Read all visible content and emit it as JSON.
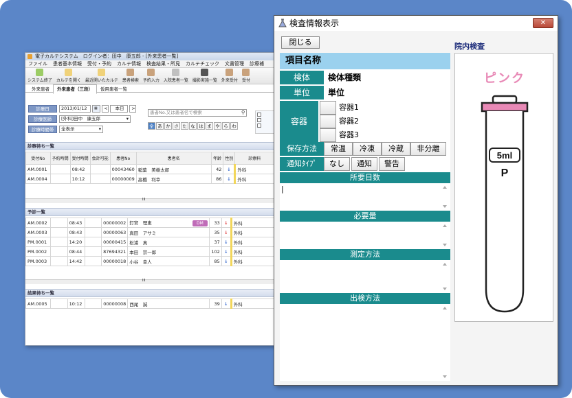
{
  "back_window": {
    "title": "電子カルテシステム　ログイン者：田中　康五郎 - [外来患者一覧]",
    "menu": [
      "ファイル",
      "患者基本情報",
      "受付・予約",
      "カルテ情報",
      "検査結果・所見",
      "カルテチェック",
      "文書管理",
      "診療補"
    ],
    "toolbar": [
      "システム終了",
      "カルテを開く",
      "最近開いたカルテ",
      "患者検索",
      "予約入力",
      "入院患者一覧",
      "撮影実施一覧",
      "外来受付",
      "受付"
    ],
    "tabs": [
      "外来患者",
      "外来患者（三段）",
      "仮用患者一覧"
    ],
    "filters": {
      "date_label": "診療日",
      "date_value": "2013/01/12",
      "today_label": "本日",
      "doctor_label": "診療医師",
      "doctor_value": "[外科]田中　康五郎",
      "time_label": "診療時間帯",
      "time_value": "全表示",
      "search_placeholder": "患者No.又は患者名で検索",
      "kana": [
        "全",
        "あ",
        "か",
        "さ",
        "た",
        "な",
        "は",
        "ま",
        "や",
        "ら",
        "わ"
      ]
    },
    "columns": [
      "受付No",
      "予約時間",
      "受付時間",
      "会計可能",
      "患者No",
      "患者名",
      "年齢",
      "性別",
      "診療科"
    ],
    "sections": {
      "waiting": "診察待ち一覧",
      "reserved": "予診一覧",
      "result_wait": "結果待ち一覧"
    },
    "waiting_rows": [
      {
        "no": "AM.0001",
        "time": "08:42",
        "pid": "00043460",
        "name": "稲葉　美樹太郎",
        "age": "42",
        "sex": "male",
        "dept": "外科"
      },
      {
        "no": "AM.0004",
        "time": "10:12",
        "pid": "00000009",
        "name": "高橋　利幸",
        "age": "86",
        "sex": "male",
        "dept": "外科"
      }
    ],
    "reserved_rows": [
      {
        "no": "AM.0002",
        "time": "08:43",
        "pid": "00000002",
        "name": "釘宮　理恵",
        "badge": "DM",
        "age": "33",
        "sex": "female",
        "dept": "外科"
      },
      {
        "no": "AM.0003",
        "time": "08:43",
        "pid": "00000063",
        "name": "真田　アサミ",
        "age": "35",
        "sex": "female",
        "dept": "外科"
      },
      {
        "no": "PM.0001",
        "time": "14:20",
        "pid": "00000415",
        "name": "松浦　真",
        "age": "37",
        "sex": "male",
        "dept": "外科"
      },
      {
        "no": "PM.0002",
        "time": "08:44",
        "pid": "87694321",
        "name": "本田　宗一郎",
        "age": "102",
        "sex": "male",
        "dept": "外科"
      },
      {
        "no": "PM.0003",
        "time": "14:42",
        "pid": "00000018",
        "name": "小谷　幸人",
        "age": "85",
        "sex": "male",
        "dept": "外科"
      }
    ],
    "result_rows": [
      {
        "no": "AM.0005",
        "time": "10:12",
        "pid": "00000008",
        "name": "西尾　誠",
        "age": "39",
        "sex": "male",
        "dept": "外科"
      }
    ],
    "scroll_mark": "III"
  },
  "dialog": {
    "title": "検査情報表示",
    "close_x": "✕",
    "close_button": "閉じる",
    "item_header": "項目名称",
    "specimen_label": "検体",
    "specimen_value": "検体種類",
    "unit_label": "単位",
    "unit_value": "単位",
    "container_label": "容器",
    "containers": [
      "容器1",
      "容器2",
      "容器3"
    ],
    "storage_label": "保存方法",
    "storage_options": [
      "常温",
      "冷凍",
      "冷蔵",
      "非分離"
    ],
    "notify_label": "通知ﾀｲﾌﾟ",
    "notify_options": [
      "なし",
      "通知",
      "警告"
    ],
    "days_label": "所要日数",
    "amount_label": "必要量",
    "method_label": "測定方法",
    "submit_label": "出検方法",
    "inhouse_label": "院内検査",
    "tube_color": "ピンク",
    "tube_color_hex": "#e889b6",
    "tube_volume": "5ml",
    "tube_code": "P"
  }
}
